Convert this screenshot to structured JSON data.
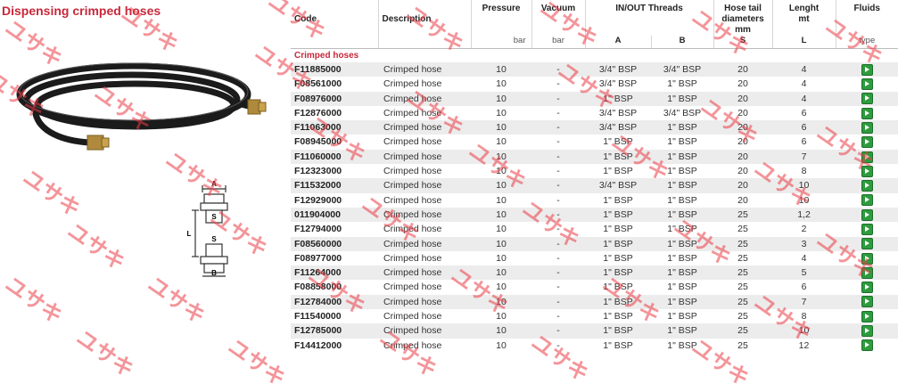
{
  "title": "Dispensing crimped hoses",
  "headers": {
    "code": "Code",
    "description": "Description",
    "pressure": "Pressure",
    "vacuum": "Vacuum",
    "threads": "IN/OUT Threads",
    "hose_tail": "Hose tail diameters mm",
    "length": "Lenght mt",
    "fluids": "Fluids",
    "pressure_unit": "bar",
    "vacuum_unit": "bar",
    "thread_a": "A",
    "thread_b": "B",
    "hose_tail_sub": "S",
    "length_sub": "L",
    "fluids_sub": "type"
  },
  "section_label": "Crimped hoses",
  "rows": [
    {
      "code": "F11885000",
      "desc": "Crimped hose",
      "pressure": "10",
      "vacuum": "-",
      "a": "3/4\" BSP",
      "b": "3/4\" BSP",
      "s": "20",
      "l": "4"
    },
    {
      "code": "F08561000",
      "desc": "Crimped hose",
      "pressure": "10",
      "vacuum": "-",
      "a": "3/4\" BSP",
      "b": "1\" BSP",
      "s": "20",
      "l": "4"
    },
    {
      "code": "F08976000",
      "desc": "Crimped hose",
      "pressure": "10",
      "vacuum": "-",
      "a": "1\" BSP",
      "b": "1\" BSP",
      "s": "20",
      "l": "4"
    },
    {
      "code": "F12876000",
      "desc": "Crimped hose",
      "pressure": "10",
      "vacuum": "-",
      "a": "3/4\" BSP",
      "b": "3/4\" BSP",
      "s": "20",
      "l": "6"
    },
    {
      "code": "F11063000",
      "desc": "Crimped hose",
      "pressure": "10",
      "vacuum": "-",
      "a": "3/4\" BSP",
      "b": "1\" BSP",
      "s": "20",
      "l": "6"
    },
    {
      "code": "F08945000",
      "desc": "Crimped hose",
      "pressure": "10",
      "vacuum": "-",
      "a": "1\" BSP",
      "b": "1\" BSP",
      "s": "20",
      "l": "6"
    },
    {
      "code": "F11060000",
      "desc": "Crimped hose",
      "pressure": "10",
      "vacuum": "-",
      "a": "1\" BSP",
      "b": "1\" BSP",
      "s": "20",
      "l": "7"
    },
    {
      "code": "F12323000",
      "desc": "Crimped hose",
      "pressure": "10",
      "vacuum": "-",
      "a": "1\" BSP",
      "b": "1\" BSP",
      "s": "20",
      "l": "8"
    },
    {
      "code": "F11532000",
      "desc": "Crimped hose",
      "pressure": "10",
      "vacuum": "-",
      "a": "3/4\" BSP",
      "b": "1\" BSP",
      "s": "20",
      "l": "10"
    },
    {
      "code": "F12929000",
      "desc": "Crimped hose",
      "pressure": "10",
      "vacuum": "-",
      "a": "1\" BSP",
      "b": "1\" BSP",
      "s": "20",
      "l": "10"
    },
    {
      "code": "011904000",
      "desc": "Crimped hose",
      "pressure": "10",
      "vacuum": "-",
      "a": "1\" BSP",
      "b": "1\" BSP",
      "s": "25",
      "l": "1,2"
    },
    {
      "code": "F12794000",
      "desc": "Crimped hose",
      "pressure": "10",
      "vacuum": "-",
      "a": "1\" BSP",
      "b": "1\" BSP",
      "s": "25",
      "l": "2"
    },
    {
      "code": "F08560000",
      "desc": "Crimped hose",
      "pressure": "10",
      "vacuum": "-",
      "a": "1\" BSP",
      "b": "1\" BSP",
      "s": "25",
      "l": "3"
    },
    {
      "code": "F08977000",
      "desc": "Crimped hose",
      "pressure": "10",
      "vacuum": "-",
      "a": "1\" BSP",
      "b": "1\" BSP",
      "s": "25",
      "l": "4"
    },
    {
      "code": "F11264000",
      "desc": "Crimped hose",
      "pressure": "10",
      "vacuum": "-",
      "a": "1\" BSP",
      "b": "1\" BSP",
      "s": "25",
      "l": "5"
    },
    {
      "code": "F08858000",
      "desc": "Crimped hose",
      "pressure": "10",
      "vacuum": "-",
      "a": "1\" BSP",
      "b": "1\" BSP",
      "s": "25",
      "l": "6"
    },
    {
      "code": "F12784000",
      "desc": "Crimped hose",
      "pressure": "10",
      "vacuum": "-",
      "a": "1\" BSP",
      "b": "1\" BSP",
      "s": "25",
      "l": "7"
    },
    {
      "code": "F11540000",
      "desc": "Crimped hose",
      "pressure": "10",
      "vacuum": "-",
      "a": "1\" BSP",
      "b": "1\" BSP",
      "s": "25",
      "l": "8"
    },
    {
      "code": "F12785000",
      "desc": "Crimped hose",
      "pressure": "10",
      "vacuum": "-",
      "a": "1\" BSP",
      "b": "1\" BSP",
      "s": "25",
      "l": "10"
    },
    {
      "code": "F14412000",
      "desc": "Crimped hose",
      "pressure": "10",
      "vacuum": "-",
      "a": "1\" BSP",
      "b": "1\" BSP",
      "s": "25",
      "l": "12"
    }
  ],
  "diagram": {
    "label_a": "A",
    "label_s_top": "S",
    "label_l": "L",
    "label_s_bottom": "S",
    "label_b": "B"
  },
  "fluid_icon": "diesel-pump-icon",
  "watermark": "ユサキ",
  "colors": {
    "title": "#c8283a",
    "section": "#c8283a",
    "fluid_icon": "#2e9b3e",
    "watermark": "#eb3c46"
  }
}
